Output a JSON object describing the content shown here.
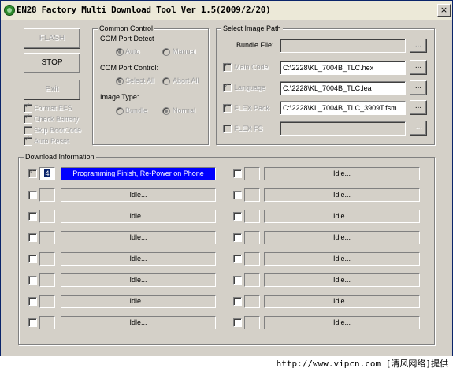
{
  "window": {
    "title": "EN28 Factory Multi Download Tool Ver 1.5(2009/2/20)",
    "close_glyph": "×"
  },
  "buttons": {
    "flash": "FLASH",
    "stop": "STOP",
    "exit": "Exit"
  },
  "options": [
    {
      "label": "Format EFS",
      "checked": true
    },
    {
      "label": "Check Battery",
      "checked": true
    },
    {
      "label": "Skip BootCode",
      "checked": false
    },
    {
      "label": "Auto Reset",
      "checked": true
    }
  ],
  "common_control": {
    "title": "Common Control",
    "com_port_detect": "COM Port Detect",
    "auto": "Auto",
    "manual": "Manual",
    "com_port_control": "COM Port Control:",
    "select_all": "Select All",
    "abort_all": "Abort All",
    "image_type": "Image Type:",
    "bundle": "Bundle",
    "normal": "Normal"
  },
  "image_path": {
    "title": "Select Image Path",
    "bundle_file_label": "Bundle File:",
    "bundle_file_value": "",
    "browse": "...",
    "main_code_label": "Main Code",
    "main_code_value": "C:\\2228\\KL_7004B_TLC.hex",
    "language_label": "Language",
    "language_value": "C:\\2228\\KL_7004B_TLC.lea",
    "flex_pack_label": "FLEX Pack",
    "flex_pack_value": "C:\\2228\\KL_7004B_TLC_3909T.fsm",
    "flex_fs_label": "FLEX FS",
    "flex_fs_value": ""
  },
  "download": {
    "title": "Download Information",
    "left": [
      {
        "port": "4",
        "status": "Programming Finish, Re-Power on Phone",
        "checked": true,
        "active": true
      },
      {
        "port": "",
        "status": "Idle...",
        "checked": false,
        "active": false
      },
      {
        "port": "",
        "status": "Idle...",
        "checked": false,
        "active": false
      },
      {
        "port": "",
        "status": "Idle...",
        "checked": false,
        "active": false
      },
      {
        "port": "",
        "status": "Idle...",
        "checked": false,
        "active": false
      },
      {
        "port": "",
        "status": "Idle...",
        "checked": false,
        "active": false
      },
      {
        "port": "",
        "status": "Idle...",
        "checked": false,
        "active": false
      },
      {
        "port": "",
        "status": "Idle...",
        "checked": false,
        "active": false
      }
    ],
    "right": [
      {
        "port": "",
        "status": "Idle...",
        "checked": false,
        "active": false
      },
      {
        "port": "",
        "status": "Idle...",
        "checked": false,
        "active": false
      },
      {
        "port": "",
        "status": "Idle...",
        "checked": false,
        "active": false
      },
      {
        "port": "",
        "status": "Idle...",
        "checked": false,
        "active": false
      },
      {
        "port": "",
        "status": "Idle...",
        "checked": false,
        "active": false
      },
      {
        "port": "",
        "status": "Idle...",
        "checked": false,
        "active": false
      },
      {
        "port": "",
        "status": "Idle...",
        "checked": false,
        "active": false
      },
      {
        "port": "",
        "status": "Idle...",
        "checked": false,
        "active": false
      }
    ]
  },
  "footer": {
    "text": "http://www.vipcn.com [清风网络]提供"
  }
}
